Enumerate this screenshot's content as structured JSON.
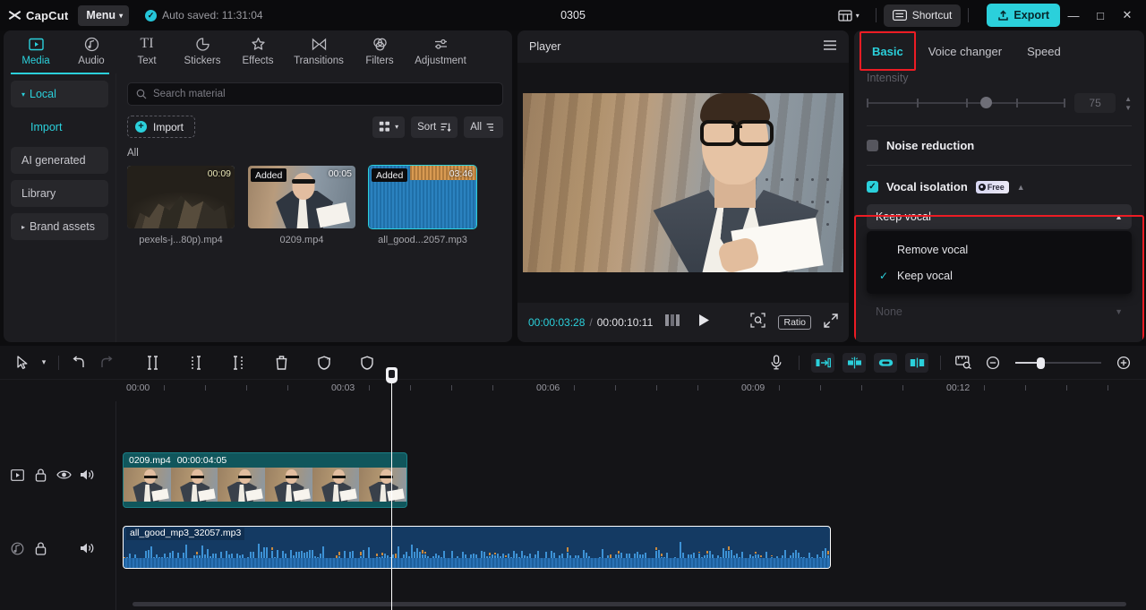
{
  "titlebar": {
    "brand": "CapCut",
    "menu_label": "Menu",
    "autosave_text": "Auto saved: 11:31:04",
    "autosave_icon": "check-circle-icon",
    "project_title": "0305",
    "layout_icon": "layout-icon",
    "shortcut_label": "Shortcut",
    "shortcut_icon": "keyboard-icon",
    "export_label": "Export",
    "export_icon": "upload-icon",
    "minimize": "—",
    "maximize": "□",
    "close": "✕",
    "accent_color": "#2bd0db"
  },
  "toolbar_tabs": [
    {
      "label": "Media",
      "icon": "media-icon",
      "active": true
    },
    {
      "label": "Audio",
      "icon": "audio-note-icon",
      "active": false
    },
    {
      "label": "Text",
      "icon": "text-icon",
      "active": false
    },
    {
      "label": "Stickers",
      "icon": "sticker-icon",
      "active": false
    },
    {
      "label": "Effects",
      "icon": "effects-sparkle-icon",
      "active": false
    },
    {
      "label": "Transitions",
      "icon": "transitions-icon",
      "active": false
    },
    {
      "label": "Filters",
      "icon": "filters-icon",
      "active": false
    },
    {
      "label": "Adjustment",
      "icon": "adjustment-sliders-icon",
      "active": false
    }
  ],
  "media_sidebar": [
    {
      "label": "Local",
      "accent": true,
      "caret": "▾"
    },
    {
      "label": "Import",
      "accent": true,
      "caret": ""
    },
    {
      "label": "AI generated",
      "accent": false,
      "caret": ""
    },
    {
      "label": "Library",
      "accent": false,
      "caret": ""
    },
    {
      "label": "Brand assets",
      "accent": false,
      "caret": "▸"
    }
  ],
  "media_panel": {
    "search_placeholder": "Search material",
    "search_value": "",
    "search_icon": "search-icon",
    "import_label": "Import",
    "grid_icon": "grid-view-icon",
    "sort_label": "Sort",
    "sort_icon": "sort-icon",
    "filter_label": "All",
    "filter_icon": "filter-icon",
    "section_label": "All",
    "items": [
      {
        "name": "pexels-j...80p).mp4",
        "duration": "00:09",
        "badge": "",
        "thumb": "rock"
      },
      {
        "name": "0209.mp4",
        "duration": "00:05",
        "badge": "Added",
        "thumb": "man"
      },
      {
        "name": "all_good...2057.mp3",
        "duration": "03:46",
        "badge": "Added",
        "thumb": "audio"
      }
    ]
  },
  "player": {
    "title": "Player",
    "menu_icon": "hamburger-icon",
    "current_time": "00:00:03:28",
    "separator": "/",
    "total_time": "00:00:10:11",
    "frames_icon": "frames-icon",
    "play_icon": "play-icon",
    "fit_icon": "fit-screen-icon",
    "ratio_label": "Ratio",
    "fullscreen_icon": "fullscreen-icon"
  },
  "right_panel": {
    "tabs": [
      {
        "label": "Basic",
        "active": true,
        "highlighted": true
      },
      {
        "label": "Voice changer",
        "active": false,
        "highlighted": false
      },
      {
        "label": "Speed",
        "active": false,
        "highlighted": false
      }
    ],
    "intensity": {
      "label": "Intensity",
      "value": "75",
      "disabled": true
    },
    "noise_reduction": {
      "label": "Noise reduction",
      "checked": false
    },
    "vocal_isolation": {
      "label": "Vocal isolation",
      "checked": true,
      "badge": "Free",
      "collapse_icon": "chevron-up-icon",
      "selected_value": "Keep vocal",
      "dropdown_open": true,
      "options": [
        {
          "label": "Remove vocal",
          "checked": false
        },
        {
          "label": "Keep vocal",
          "checked": true
        }
      ],
      "below_select_value": "None",
      "highlight_color": "#ec1c24"
    }
  },
  "timeline": {
    "tools_left": [
      {
        "icon": "cursor-select-icon",
        "name": "select-tool"
      },
      {
        "icon": "chevron-down-icon",
        "name": "select-tool-dropdown"
      },
      {
        "icon": "undo-icon",
        "name": "undo-button"
      },
      {
        "icon": "redo-icon",
        "name": "redo-button",
        "disabled": true
      },
      {
        "icon": "split-icon",
        "name": "split-button"
      },
      {
        "icon": "trim-left-icon",
        "name": "trim-left-button"
      },
      {
        "icon": "trim-right-icon",
        "name": "trim-right-button"
      },
      {
        "icon": "delete-icon",
        "name": "delete-button"
      },
      {
        "icon": "ai-shield-icon",
        "name": "ai-tool-button"
      },
      {
        "icon": "shield-icon",
        "name": "shield-button"
      }
    ],
    "tools_right": [
      {
        "icon": "microphone-icon",
        "name": "record-voiceover-button"
      },
      {
        "icon": "snap-start-icon",
        "name": "snap-start-button"
      },
      {
        "icon": "auto-cut-icon",
        "name": "auto-cut-button"
      },
      {
        "icon": "link-icon",
        "name": "link-clips-button"
      },
      {
        "icon": "mirror-icon",
        "name": "mirror-button"
      },
      {
        "icon": "preview-ruler-icon",
        "name": "preview-scale-button"
      },
      {
        "icon": "zoom-out-icon",
        "name": "zoom-out-button"
      },
      {
        "icon": "zoom-in-icon",
        "name": "zoom-in-button"
      }
    ],
    "ruler_labels": [
      "00:00",
      "00:03",
      "00:06",
      "00:09",
      "00:12"
    ],
    "video_track": {
      "header_icons": [
        "video-track-icon",
        "lock-icon",
        "eye-icon",
        "volume-icon"
      ],
      "clip_name": "0209.mp4",
      "clip_duration": "00:00:04:05"
    },
    "audio_track": {
      "header_icons": [
        "audio-track-icon",
        "lock-icon",
        "",
        "volume-icon"
      ],
      "clip_name": "all_good_mp3_32057.mp3"
    }
  }
}
